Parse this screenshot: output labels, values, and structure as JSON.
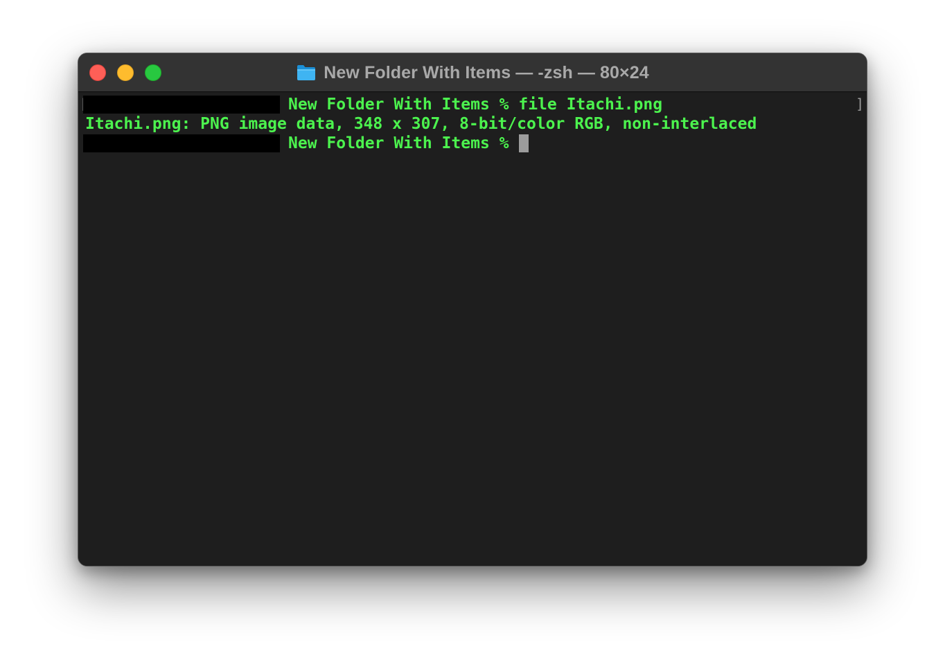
{
  "window": {
    "title": "New Folder With Items — -zsh — 80×24",
    "title_icon": "folder-icon",
    "traffic_lights": {
      "close_color": "#fe5f57",
      "minimize_color": "#febc2e",
      "zoom_color": "#28c840"
    }
  },
  "terminal": {
    "text_color": "#4cf34e",
    "background": "#1e1e1e",
    "left_bracket": "[",
    "right_bracket": "]",
    "lines": [
      {
        "prompt": "New Folder With Items %",
        "command": " file Itachi.png",
        "redacted_prefix": true
      },
      {
        "output": "Itachi.png: PNG image data, 348 x 307, 8-bit/color RGB, non-interlaced"
      },
      {
        "prompt": "New Folder With Items %",
        "command": "",
        "redacted_prefix": true
      }
    ]
  }
}
